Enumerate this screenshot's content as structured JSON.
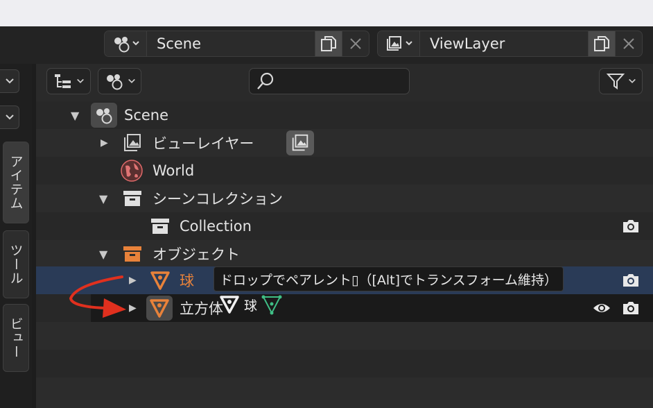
{
  "header": {
    "scene_name": "Scene",
    "viewlayer_name": "ViewLayer"
  },
  "left_tabs": [
    "アイテム",
    "ツール",
    "ビュー"
  ],
  "outliner": {
    "search_placeholder": "",
    "rows": {
      "scene": "Scene",
      "viewlayer": "ビューレイヤー",
      "world": "World",
      "scene_collection": "シーンコレクション",
      "collection": "Collection",
      "objects": "オブジェクト",
      "sphere": "球",
      "cube": "立方体"
    }
  },
  "tooltip": {
    "text": "ドロップでペアレント▯（[Alt]でトランスフォーム維持）"
  },
  "drag": {
    "label": "球"
  },
  "colors": {
    "accent_orange": "#e8823a",
    "selection": "#2a3b57",
    "arrow_red": "#e0301e",
    "mesh_green": "#3fbf86"
  }
}
